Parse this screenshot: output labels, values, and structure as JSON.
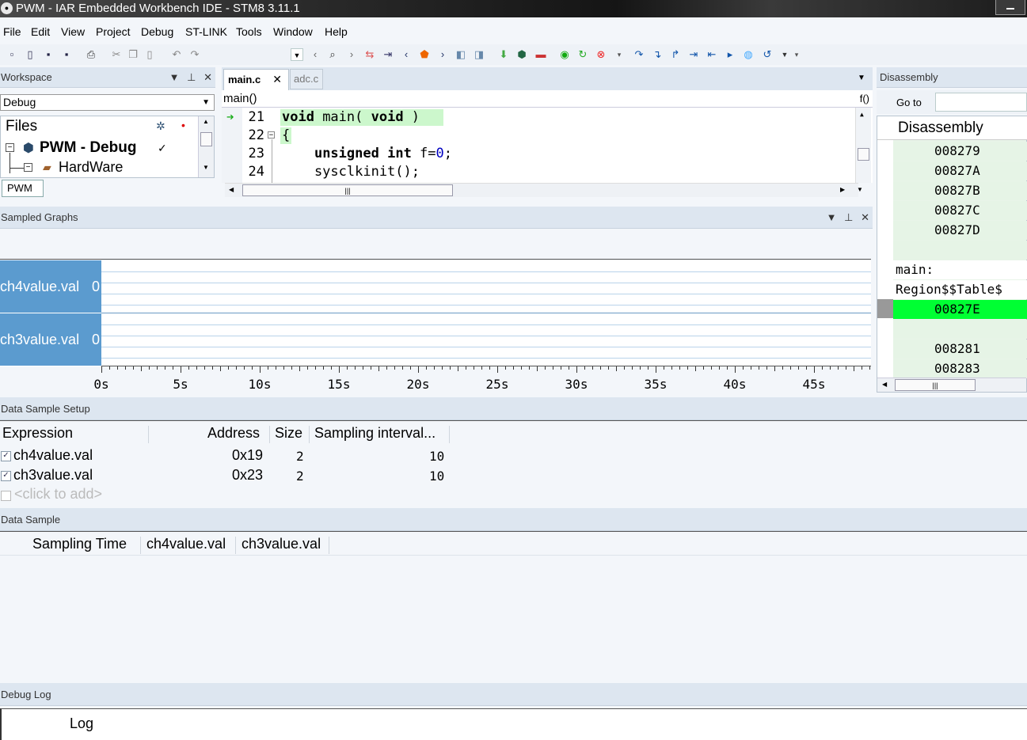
{
  "window": {
    "title": "PWM - IAR Embedded Workbench IDE - STM8 3.11.1"
  },
  "menu": [
    "File",
    "Edit",
    "View",
    "Project",
    "Debug",
    "ST-LINK",
    "Tools",
    "Window",
    "Help"
  ],
  "workspace": {
    "header": "Workspace",
    "config": "Debug",
    "files_label": "Files",
    "project": "PWM - Debug",
    "folder": "HardWare",
    "tab": "PWM"
  },
  "editor": {
    "tabs": [
      "main.c",
      "adc.c"
    ],
    "function": "main()",
    "func_button": "f()",
    "lines": [
      {
        "num": "21",
        "tokens": [
          {
            "t": "void",
            "k": "kw"
          },
          {
            "t": " main( "
          },
          {
            "t": "void",
            "k": "kw"
          },
          {
            "t": " )"
          }
        ]
      },
      {
        "num": "22",
        "tokens": [
          {
            "t": "{"
          }
        ]
      },
      {
        "num": "23",
        "tokens": [
          {
            "t": "    "
          },
          {
            "t": "unsigned",
            "k": "kw"
          },
          {
            "t": " "
          },
          {
            "t": "int",
            "k": "kw"
          },
          {
            "t": " f="
          },
          {
            "t": "0",
            "k": "num"
          },
          {
            "t": ";"
          }
        ]
      },
      {
        "num": "24",
        "tokens": [
          {
            "t": "    sysclkinit();"
          }
        ]
      }
    ]
  },
  "sampled_graphs": {
    "header": "Sampled Graphs",
    "lanes": [
      {
        "name": "ch4value.val",
        "value": "0"
      },
      {
        "name": "ch3value.val",
        "value": "0"
      }
    ],
    "time_ticks": [
      "0s",
      "5s",
      "10s",
      "15s",
      "20s",
      "25s",
      "30s",
      "35s",
      "40s",
      "45s"
    ]
  },
  "disassembly": {
    "header": "Disassembly",
    "goto_label": "Go to",
    "column": "Disassembly",
    "rows": [
      {
        "text": "008279"
      },
      {
        "text": "00827A"
      },
      {
        "text": "00827B"
      },
      {
        "text": "00827C"
      },
      {
        "text": "00827D"
      },
      {
        "text": ""
      },
      {
        "text": "main:"
      },
      {
        "text": "Region$$Table$"
      },
      {
        "text": "00827E"
      },
      {
        "text": ""
      },
      {
        "text": "008281"
      },
      {
        "text": "008283"
      }
    ]
  },
  "data_sample_setup": {
    "header": "Data Sample Setup",
    "columns": [
      "Expression",
      "Address",
      "Size",
      "Sampling interval..."
    ],
    "rows": [
      {
        "expression": "ch4value.val",
        "address": "0x19",
        "size": "2",
        "interval": "10"
      },
      {
        "expression": "ch3value.val",
        "address": "0x23",
        "size": "2",
        "interval": "10"
      }
    ],
    "add_placeholder": "<click to add>"
  },
  "data_sample": {
    "header": "Data Sample",
    "columns": [
      "Sampling Time",
      "ch4value.val",
      "ch3value.val"
    ]
  },
  "debug_log": {
    "header": "Debug Log",
    "column": "Log"
  },
  "colors": {
    "lane_bg": "#5b9bcf",
    "current_line": "#ccf7cc",
    "disasm_highlight": "#00ff33"
  }
}
